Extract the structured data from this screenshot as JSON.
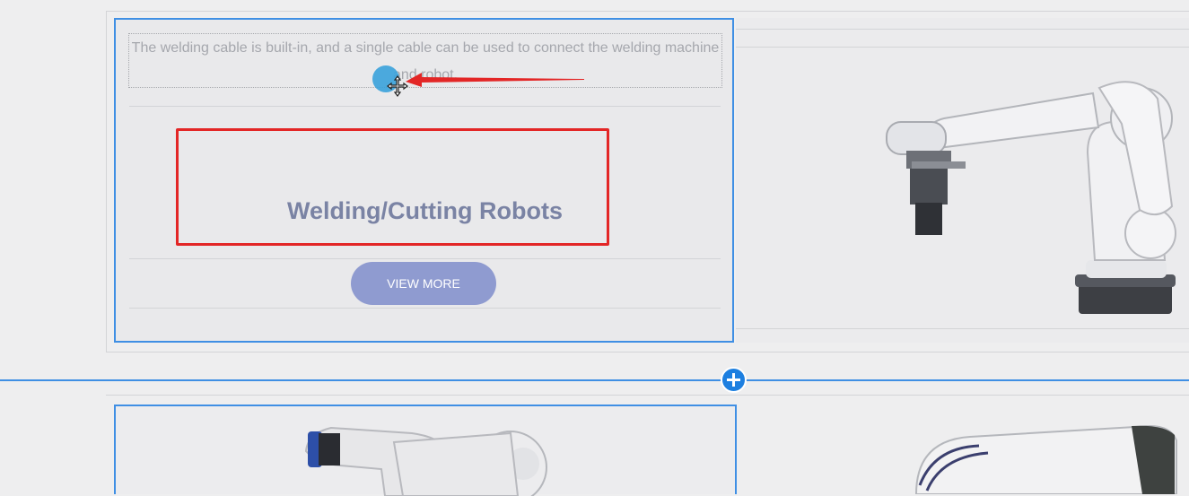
{
  "product_card": {
    "description": "The welding cable is built-in, and a single cable can be used to connect the welding machine and robot.",
    "title": "Welding/Cutting Robots",
    "button_label": "VIEW MORE"
  },
  "images": {
    "right_image": "industrial-robot-arm",
    "bottom_left_image": "collaborative-robot-arm",
    "bottom_right_image": "painting-robot-arm"
  },
  "icons": {
    "add_section": "plus-icon",
    "cursor": "move-cursor-icon",
    "annotation": "red-arrow"
  },
  "colors": {
    "selection": "#3f8fe4",
    "heading": "#7a83a4",
    "button": "#8f9bd0",
    "annotation": "#e32626",
    "add_button": "#1d7fe0"
  }
}
